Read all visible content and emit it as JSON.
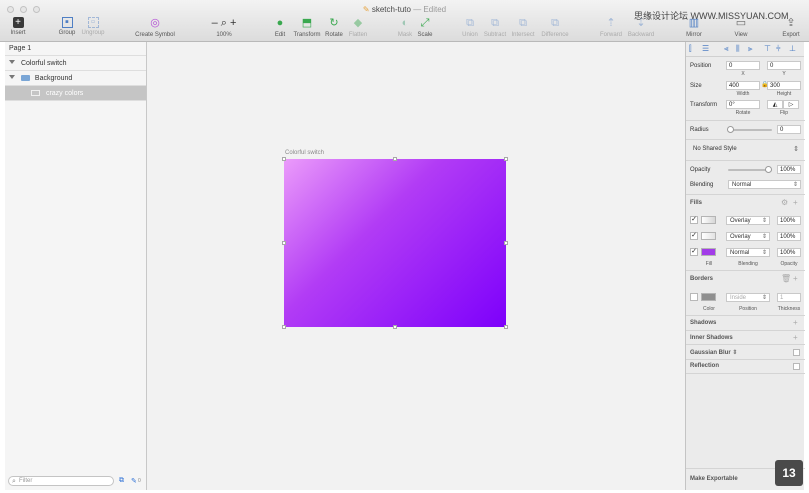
{
  "window": {
    "title": "sketch-tuto",
    "title_suffix": "— Edited",
    "watermark": "思缘设计论坛 WWW.MISSYUAN.COM"
  },
  "toolbar": {
    "insert": {
      "label": "Insert",
      "icon": "plus-square-icon"
    },
    "group": {
      "label": "Group",
      "icon": "group-icon"
    },
    "ungroup": {
      "label": "Ungroup",
      "icon": "ungroup-icon"
    },
    "create_symbol": {
      "label": "Create Symbol",
      "icon": "symbol-icon"
    },
    "zoom": {
      "label": "100%",
      "minus": "–",
      "plus": "+",
      "icon": "magnifier-icon"
    },
    "edit": {
      "label": "Edit",
      "icon": "edit-icon"
    },
    "transform": {
      "label": "Transform",
      "icon": "transform-icon"
    },
    "rotate": {
      "label": "Rotate",
      "icon": "rotate-icon"
    },
    "flatten": {
      "label": "Flatten",
      "icon": "flatten-icon"
    },
    "mask": {
      "label": "Mask",
      "icon": "mask-icon"
    },
    "scale": {
      "label": "Scale",
      "icon": "scale-icon"
    },
    "union": {
      "label": "Union",
      "icon": "union-icon"
    },
    "subtract": {
      "label": "Subtract",
      "icon": "subtract-icon"
    },
    "intersect": {
      "label": "Intersect",
      "icon": "intersect-icon"
    },
    "difference": {
      "label": "Difference",
      "icon": "difference-icon"
    },
    "forward": {
      "label": "Forward",
      "icon": "forward-icon"
    },
    "backward": {
      "label": "Backward",
      "icon": "backward-icon"
    },
    "mirror": {
      "label": "Mirror",
      "icon": "mirror-icon"
    },
    "view": {
      "label": "View",
      "icon": "view-icon"
    },
    "export": {
      "label": "Export",
      "icon": "export-icon"
    }
  },
  "sidebar": {
    "page": "Page 1",
    "layers": [
      {
        "label": "Colorful switch",
        "kind": "artboard"
      },
      {
        "label": "Background",
        "kind": "group"
      },
      {
        "label": "crazy colors",
        "kind": "layer",
        "selected": true
      }
    ],
    "filter_placeholder": "Filter",
    "footer_count": "0"
  },
  "canvas": {
    "artboard_label": "Colorful switch",
    "gradient": [
      "#eb9bfa",
      "#b23cf5",
      "#7d00fb"
    ]
  },
  "inspector": {
    "position": {
      "label": "Position",
      "x": "0",
      "y": "0",
      "x_sub": "X",
      "y_sub": "Y"
    },
    "size": {
      "label": "Size",
      "width": "400",
      "height": "300",
      "w_sub": "Width",
      "h_sub": "Height"
    },
    "transform": {
      "label": "Transform",
      "rotate": "0°",
      "rotate_sub": "Rotate",
      "flip_sub": "Flip"
    },
    "radius": {
      "label": "Radius",
      "value": "0"
    },
    "shared_style": "No Shared Style",
    "opacity": {
      "label": "Opacity",
      "value": "100%",
      "level": 1.0
    },
    "blending": {
      "label": "Blending",
      "value": "Normal"
    },
    "fills": {
      "label": "Fills",
      "items": [
        {
          "blend": "Overlay",
          "opacity": "100%",
          "color": "#d6d6d6"
        },
        {
          "blend": "Overlay",
          "opacity": "100%",
          "color": "#e3e3e3"
        },
        {
          "blend": "Normal",
          "opacity": "100%",
          "color": "#a23ce8"
        }
      ],
      "sub_fill": "Fill",
      "sub_blending": "Blending",
      "sub_opacity": "Opacity"
    },
    "borders": {
      "label": "Borders",
      "position": "Inside",
      "thickness": "1",
      "sub_color": "Color",
      "sub_position": "Position",
      "sub_thickness": "Thickness"
    },
    "shadows": "Shadows",
    "inner_shadows": "Inner Shadows",
    "gaussian_blur": "Gaussian Blur",
    "reflection": "Reflection",
    "make_exportable": "Make Exportable"
  },
  "badge": "13"
}
